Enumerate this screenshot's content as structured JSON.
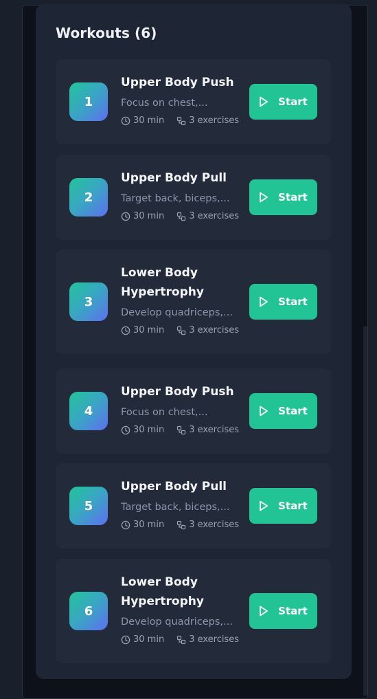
{
  "panel": {
    "title": "Workouts (6)"
  },
  "colors": {
    "page_bg": "#1a1f2c",
    "panel_bg": "#1e2535",
    "card_bg": "#232b3b",
    "accent_green": "#22c495",
    "badge_gradient": [
      "#22c49a",
      "#5d6ff0"
    ]
  },
  "icons": {
    "duration": "clock-icon",
    "exercises": "exercises-icon",
    "start": "play-icon"
  },
  "workouts": [
    {
      "number": "1",
      "title": "Upper Body Push",
      "description": "Focus on chest,...",
      "duration": "30 min",
      "exercises": "3 exercises",
      "action": "Start"
    },
    {
      "number": "2",
      "title": "Upper Body Pull",
      "description": "Target back, biceps,...",
      "duration": "30 min",
      "exercises": "3 exercises",
      "action": "Start"
    },
    {
      "number": "3",
      "title": "Lower Body Hypertrophy",
      "description": "Develop quadriceps,...",
      "duration": "30 min",
      "exercises": "3 exercises",
      "action": "Start"
    },
    {
      "number": "4",
      "title": "Upper Body Push",
      "description": "Focus on chest,...",
      "duration": "30 min",
      "exercises": "3 exercises",
      "action": "Start"
    },
    {
      "number": "5",
      "title": "Upper Body Pull",
      "description": "Target back, biceps,...",
      "duration": "30 min",
      "exercises": "3 exercises",
      "action": "Start"
    },
    {
      "number": "6",
      "title": "Lower Body Hypertrophy",
      "description": "Develop quadriceps,...",
      "duration": "30 min",
      "exercises": "3 exercises",
      "action": "Start"
    }
  ]
}
